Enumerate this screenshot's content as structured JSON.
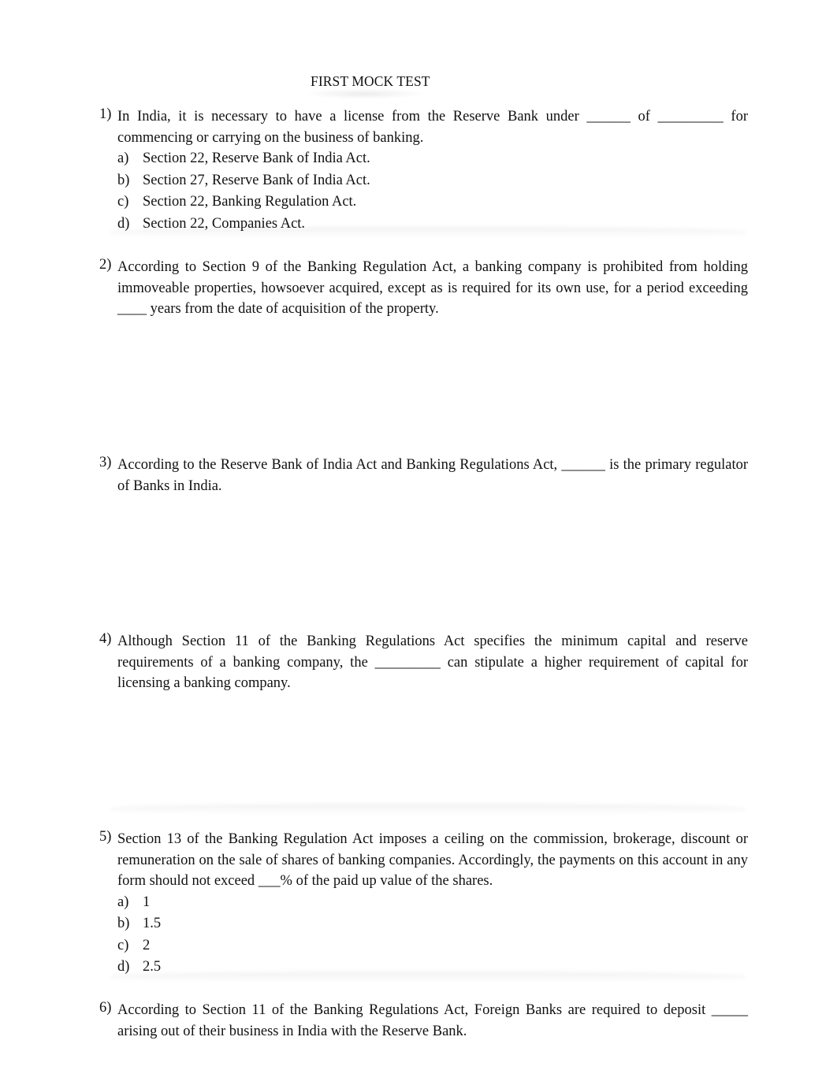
{
  "document": {
    "title": "FIRST MOCK TEST",
    "questions": [
      {
        "number": "1)",
        "text": "In India, it is necessary to have a license from the Reserve Bank under ______ of _________ for commencing or carrying on the business of banking.",
        "options": [
          {
            "letter": "a)",
            "text": "Section 22, Reserve Bank of India Act."
          },
          {
            "letter": "b)",
            "text": "Section 27, Reserve Bank of India Act."
          },
          {
            "letter": "c)",
            "text": "Section 22, Banking Regulation Act."
          },
          {
            "letter": "d)",
            "text": "Section 22, Companies Act."
          }
        ]
      },
      {
        "number": "2)",
        "text": "According to Section 9 of the Banking Regulation Act, a banking company is prohibited from holding immoveable properties, howsoever acquired, except as is required for its own use, for a period exceeding ____ years from the date of acquisition of the property.",
        "options": []
      },
      {
        "number": "3)",
        "text": "According to the Reserve Bank of India Act and Banking Regulations Act, ______ is the primary regulator of Banks in India.",
        "options": []
      },
      {
        "number": "4)",
        "text": "Although Section 11 of the Banking Regulations Act specifies the minimum capital and reserve requirements of a banking company, the _________ can stipulate a higher requirement of capital for licensing a banking company.",
        "options": []
      },
      {
        "number": "5)",
        "text": "Section 13 of the Banking Regulation Act imposes a ceiling on the commission, brokerage, discount or remuneration on the sale of shares of banking companies. Accordingly, the payments on this account in any form should not exceed ___% of the paid up value of the shares.",
        "options": [
          {
            "letter": "a)",
            "text": "1"
          },
          {
            "letter": "b)",
            "text": "1.5"
          },
          {
            "letter": "c)",
            "text": "2"
          },
          {
            "letter": "d)",
            "text": "2.5"
          }
        ]
      },
      {
        "number": "6)",
        "text": "According to Section 11 of the Banking Regulations Act, Foreign Banks are required to deposit _____ arising out of their business in India with the Reserve Bank.",
        "options": []
      }
    ]
  }
}
